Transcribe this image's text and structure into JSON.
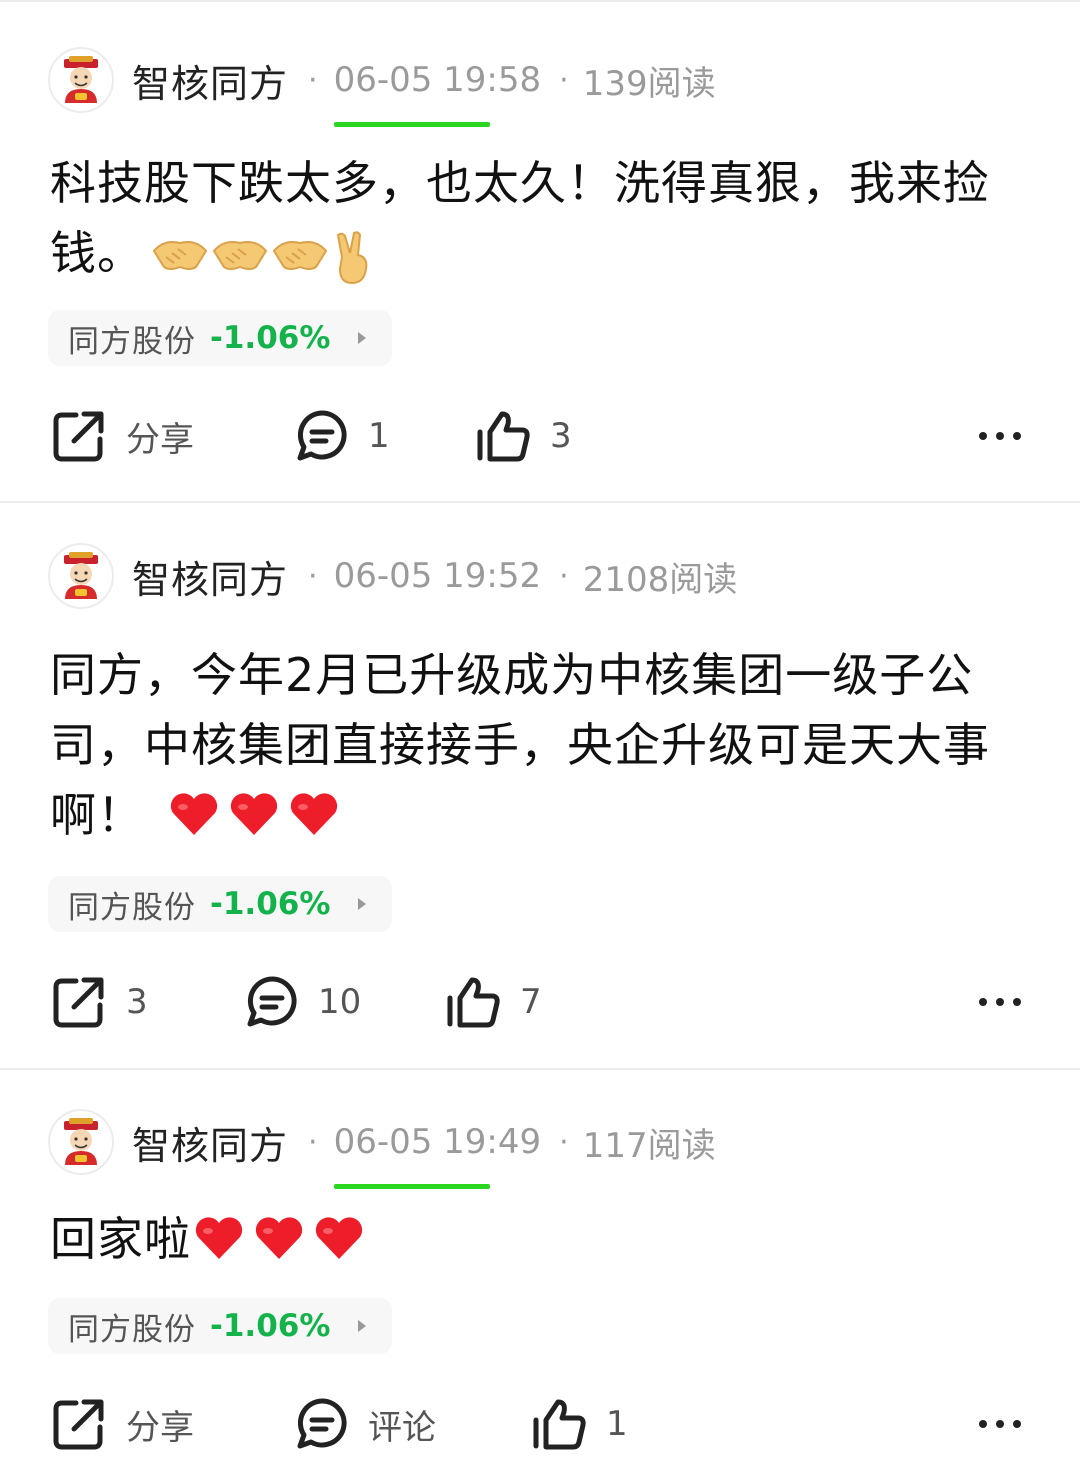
{
  "posts": [
    {
      "author": "智核同方",
      "time": "06-05 19:58",
      "reads": "139阅读",
      "content": "科技股下跌太多，也太久！洗得真狠，我来捡钱。",
      "emojis": [
        "handshake",
        "handshake",
        "handshake",
        "victory-hand"
      ],
      "stock": {
        "name": "同方股份",
        "change": "-1.06%"
      },
      "share_label": "分享",
      "comment_label": "1",
      "like_label": "3"
    },
    {
      "author": "智核同方",
      "time": "06-05 19:52",
      "reads": "2108阅读",
      "content": "同方，今年2月已升级成为中核集团一级子公司，中核集团直接接手，央企升级可是天大事啊！",
      "emojis": [
        "red-heart",
        "red-heart",
        "red-heart"
      ],
      "stock": {
        "name": "同方股份",
        "change": "-1.06%"
      },
      "share_label": "3",
      "comment_label": "10",
      "like_label": "7"
    },
    {
      "author": "智核同方",
      "time": "06-05 19:49",
      "reads": "117阅读",
      "content": "回家啦",
      "emojis": [
        "red-heart",
        "red-heart",
        "red-heart"
      ],
      "stock": {
        "name": "同方股份",
        "change": "-1.06%"
      },
      "share_label": "分享",
      "comment_label": "评论",
      "like_label": "1"
    }
  ],
  "colors": {
    "accent_green": "#2bd61f",
    "stock_down": "#14b24a",
    "meta_gray": "#9a9a9a",
    "divider": "#ececec"
  },
  "icons": [
    "share-icon",
    "comment-icon",
    "like-icon",
    "more-icon",
    "chevron-right-icon",
    "avatar-icon"
  ]
}
